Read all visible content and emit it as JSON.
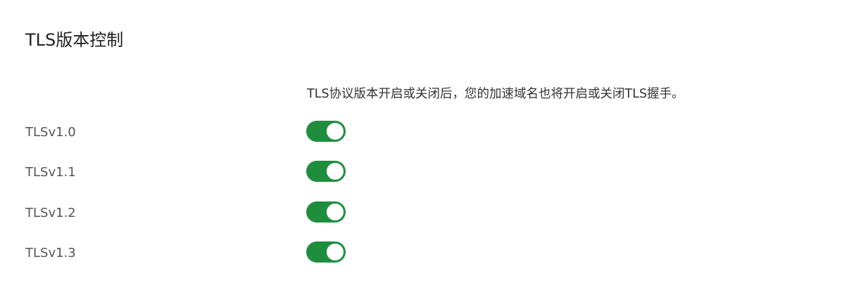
{
  "section": {
    "title": "TLS版本控制",
    "description": "TLS协议版本开启或关闭后，您的加速域名也将开启或关闭TLS握手。"
  },
  "colors": {
    "toggle_on": "#1e8e3e",
    "knob": "#ffffff"
  },
  "tls_versions": [
    {
      "label": "TLSv1.0",
      "enabled": true
    },
    {
      "label": "TLSv1.1",
      "enabled": true
    },
    {
      "label": "TLSv1.2",
      "enabled": true
    },
    {
      "label": "TLSv1.3",
      "enabled": true
    }
  ]
}
